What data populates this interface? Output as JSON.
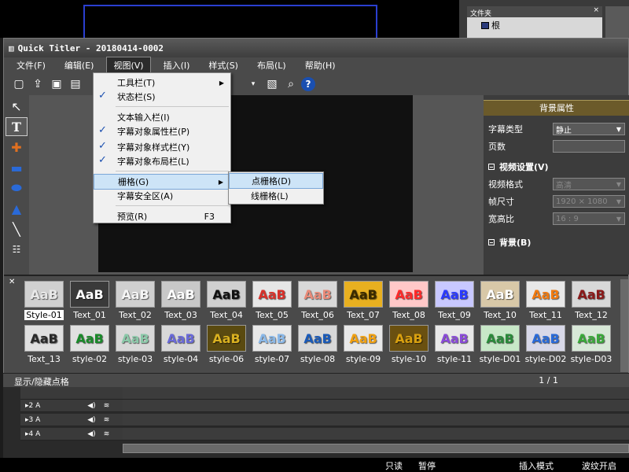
{
  "background": {
    "folder_panel_title": "文件夹",
    "folder_close": "×",
    "folder_node": "根"
  },
  "window": {
    "title": "Quick Titler - 20180414-0002",
    "menus": [
      "文件(F)",
      "编辑(E)",
      "视图(V)",
      "插入(I)",
      "样式(S)",
      "布局(L)",
      "帮助(H)"
    ],
    "active_menu_index": 2
  },
  "view_menu": {
    "items": [
      {
        "label": "工具栏(T)",
        "checked": false,
        "submenu": true
      },
      {
        "label": "状态栏(S)",
        "checked": true
      },
      {
        "label": "文本输入栏(I)",
        "checked": false
      },
      {
        "label": "字幕对象属性栏(P)",
        "checked": true
      },
      {
        "label": "字幕对象样式栏(Y)",
        "checked": true
      },
      {
        "label": "字幕对象布局栏(L)",
        "checked": true
      },
      {
        "label": "栅格(G)",
        "checked": false,
        "submenu": true,
        "highlighted": true
      },
      {
        "label": "字幕安全区(A)",
        "checked": false
      },
      {
        "label": "预览(R)",
        "shortcut": "F3"
      }
    ],
    "grid_submenu": [
      "点栅格(D)",
      "线栅格(L)"
    ]
  },
  "properties": {
    "header": "背景属性",
    "subtitle_type_label": "字幕类型",
    "subtitle_type_value": "静止",
    "page_label": "页数",
    "video_section": "视频设置(V)",
    "video_format_label": "视频格式",
    "video_format_value": "高清",
    "frame_size_label": "帧尺寸",
    "frame_size_value": "1920 × 1080",
    "aspect_label": "宽高比",
    "aspect_value": "16 : 9",
    "bg_section": "背景(B)"
  },
  "styles": [
    {
      "name": "Style-01",
      "text": "AaB",
      "color": "#e8e8e8",
      "bg": "#d0d0d0"
    },
    {
      "name": "Text_01",
      "text": "AaB",
      "color": "#ffffff",
      "bg": "#3a3a3a"
    },
    {
      "name": "Text_02",
      "text": "AaB",
      "color": "#f4f4f4",
      "bg": "#cfcfcf"
    },
    {
      "name": "Text_03",
      "text": "AaB",
      "color": "#ffffff",
      "bg": "#c8c8c8"
    },
    {
      "name": "Text_04",
      "text": "AaB",
      "color": "#111111",
      "bg": "#d0d0d0"
    },
    {
      "name": "Text_05",
      "text": "AaB",
      "color": "#d8302a",
      "bg": "#e6e6e6"
    },
    {
      "name": "Text_06",
      "text": "AaB",
      "color": "#e88a78",
      "bg": "#d8d8d8"
    },
    {
      "name": "Text_07",
      "text": "AaB",
      "color": "#3a2a00",
      "bg": "#e8b020"
    },
    {
      "name": "Text_08",
      "text": "AaB",
      "color": "#ff2a2a",
      "bg": "#ffc8c8"
    },
    {
      "name": "Text_09",
      "text": "AaB",
      "color": "#2a3aff",
      "bg": "#c8c8ff"
    },
    {
      "name": "Text_10",
      "text": "AaB",
      "color": "#ffffff",
      "bg": "#d8c8a8"
    },
    {
      "name": "Text_11",
      "text": "AaB",
      "color": "#f07a10",
      "bg": "#e8e8e8"
    },
    {
      "name": "Text_12",
      "text": "AaB",
      "color": "#8a1a1a",
      "bg": "#d8d8d8"
    },
    {
      "name": "Text_13",
      "text": "AaB",
      "color": "#2a2a2a",
      "bg": "#e0e0e0"
    },
    {
      "name": "style-02",
      "text": "AaB",
      "color": "#1a8a2a",
      "bg": "#e0e0e0"
    },
    {
      "name": "style-03",
      "text": "AaB",
      "color": "#8ac8a8",
      "bg": "#d8d8d8"
    },
    {
      "name": "style-04",
      "text": "AaB",
      "color": "#6a6ad8",
      "bg": "#d8d8d8"
    },
    {
      "name": "style-06",
      "text": "AaB",
      "color": "#d8b020",
      "bg": "#5a4a10"
    },
    {
      "name": "style-07",
      "text": "AaB",
      "color": "#8ab8e8",
      "bg": "#e8e8e8"
    },
    {
      "name": "style-08",
      "text": "AaB",
      "color": "#1a5ab8",
      "bg": "#d8d8d8"
    },
    {
      "name": "style-09",
      "text": "AaB",
      "color": "#f0a010",
      "bg": "#e8e8e8"
    },
    {
      "name": "style-10",
      "text": "AaB",
      "color": "#d8a010",
      "bg": "#6a5010"
    },
    {
      "name": "style-11",
      "text": "AaB",
      "color": "#8a4ad8",
      "bg": "#e8e8e8"
    },
    {
      "name": "style-D01",
      "text": "AaB",
      "color": "#2a8a3a",
      "bg": "#c8e8c8"
    },
    {
      "name": "style-D02",
      "text": "AaB",
      "color": "#2a6ad8",
      "bg": "#d8d8e8"
    },
    {
      "name": "style-D03",
      "text": "AaB",
      "color": "#3aa83a",
      "bg": "#d8e8d8"
    }
  ],
  "status": {
    "text": "显示/隐藏点格",
    "page": "1 / 1"
  },
  "tracks": [
    {
      "name": "▸2 A"
    },
    {
      "name": "▸3 A"
    },
    {
      "name": "▸4 A"
    }
  ],
  "bottom_status": [
    "只读",
    "暂停",
    "插入模式",
    "波纹开启"
  ]
}
